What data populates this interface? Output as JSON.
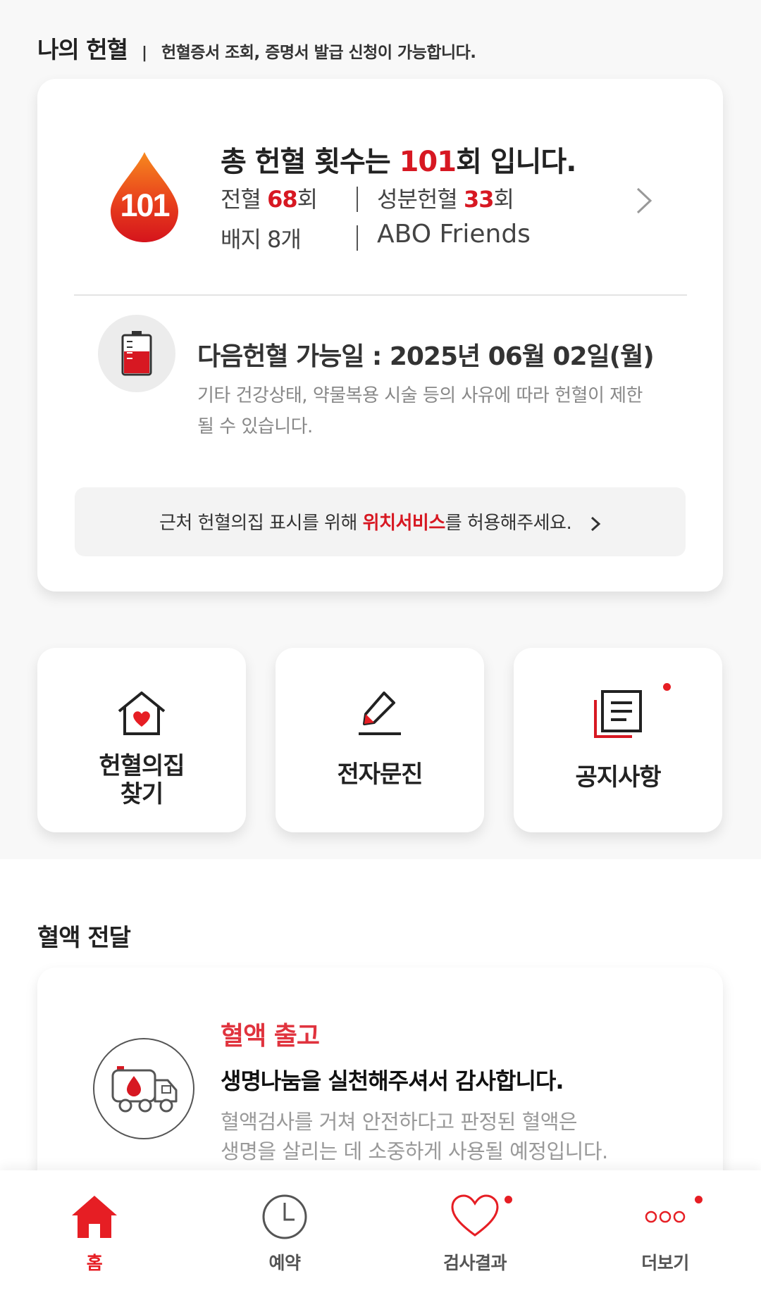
{
  "header": {
    "title": "나의 헌혈",
    "separator": "|",
    "subtitle": "헌혈증서 조회, 증명서 발급 신청이 가능합니다."
  },
  "summary": {
    "drop_number": "101",
    "total_prefix": "총 헌혈 횟수는 ",
    "total_count": "101",
    "total_suffix": "회 입니다.",
    "whole_blood_label": "전혈 ",
    "whole_blood_count": "68",
    "whole_blood_unit": "회",
    "component_label": "성분헌혈 ",
    "component_count": "33",
    "component_unit": "회",
    "badge_text": "배지 8개",
    "friends_text": "ABO Friends"
  },
  "next_donation": {
    "date_text": "다음헌혈 가능일 : 2025년 06월 02일(월)",
    "note": "기타 건강상태, 약물복용 시술 등의 사유에 따라 헌혈이 제한될 수 있습니다."
  },
  "location_bar": {
    "prefix": "근처 헌혈의집 표시를 위해 ",
    "highlight": "위치서비스",
    "suffix": "를 허용해주세요."
  },
  "quick_menu": [
    {
      "line1": "헌혈의집",
      "line2": "찾기",
      "icon": "house-heart-icon"
    },
    {
      "line1": "전자문진",
      "line2": "",
      "icon": "pen-icon"
    },
    {
      "line1": "공지사항",
      "line2": "",
      "icon": "notice-document-icon",
      "has_new": true
    }
  ],
  "delivery": {
    "section_title": "혈액 전달",
    "title": "혈액 출고",
    "heading": "생명나눔을 실천해주셔서 감사합니다.",
    "body_line1": "혈액검사를 거쳐 안전하다고 판정된 혈액은",
    "body_line2": "생명을 살리는 데 소중하게 사용될 예정입니다."
  },
  "bottom_nav": [
    {
      "label": "홈",
      "icon": "home-icon",
      "active": true
    },
    {
      "label": "예약",
      "icon": "clock-icon",
      "active": false
    },
    {
      "label": "검사결과",
      "icon": "heart-icon",
      "active": false,
      "has_new": true
    },
    {
      "label": "더보기",
      "icon": "more-icon",
      "active": false,
      "has_new": true
    }
  ],
  "colors": {
    "accent": "#d71822",
    "background": "#f8f8f8",
    "card": "#ffffff",
    "muted_text": "#888888"
  }
}
